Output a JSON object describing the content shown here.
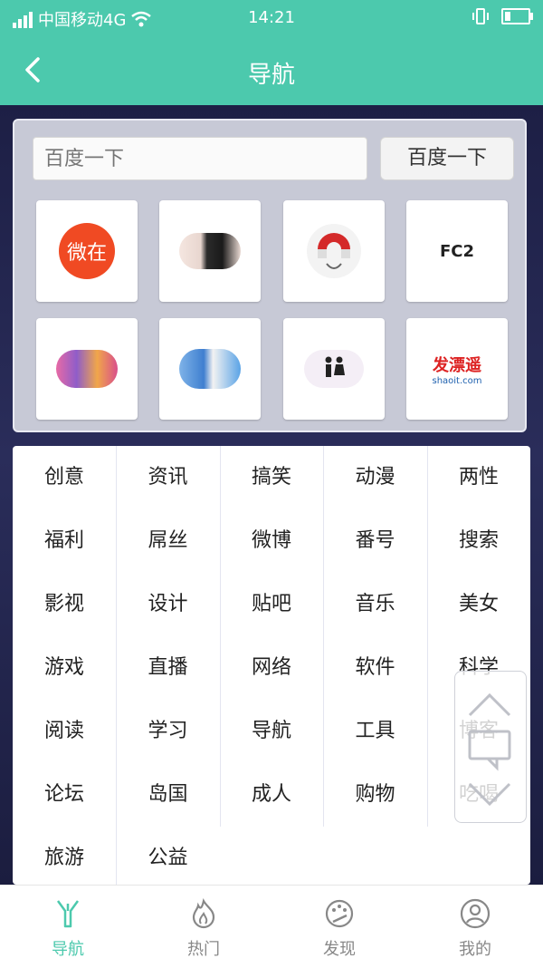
{
  "status_bar": {
    "carrier": "中国移动4G",
    "time": "14:21"
  },
  "header": {
    "title": "导航"
  },
  "search": {
    "placeholder": "百度一下",
    "button_label": "百度一下"
  },
  "shortcuts": [
    {
      "name": "weizai",
      "label": "微在"
    },
    {
      "name": "image-2",
      "label": ""
    },
    {
      "name": "magnet",
      "label": ""
    },
    {
      "name": "fc2",
      "label": "FC2"
    },
    {
      "name": "anime",
      "label": ""
    },
    {
      "name": "doraemon",
      "label": ""
    },
    {
      "name": "adult",
      "label": ""
    },
    {
      "name": "shaoit",
      "label": "发漂遥",
      "sub": "shaoit.com"
    }
  ],
  "categories": [
    "创意",
    "资讯",
    "搞笑",
    "动漫",
    "两性",
    "福利",
    "屌丝",
    "微博",
    "番号",
    "搜索",
    "影视",
    "设计",
    "贴吧",
    "音乐",
    "美女",
    "游戏",
    "直播",
    "网络",
    "软件",
    "科学",
    "阅读",
    "学习",
    "导航",
    "工具",
    "博客",
    "论坛",
    "岛国",
    "成人",
    "购物",
    "吃喝",
    "旅游",
    "公益"
  ],
  "tabs": [
    {
      "label": "导航",
      "icon": "navigation-icon",
      "active": true
    },
    {
      "label": "热门",
      "icon": "fire-icon",
      "active": false
    },
    {
      "label": "发现",
      "icon": "palette-icon",
      "active": false
    },
    {
      "label": "我的",
      "icon": "user-icon",
      "active": false
    }
  ],
  "colors": {
    "accent": "#4cc9ad",
    "background": "#23254a"
  }
}
